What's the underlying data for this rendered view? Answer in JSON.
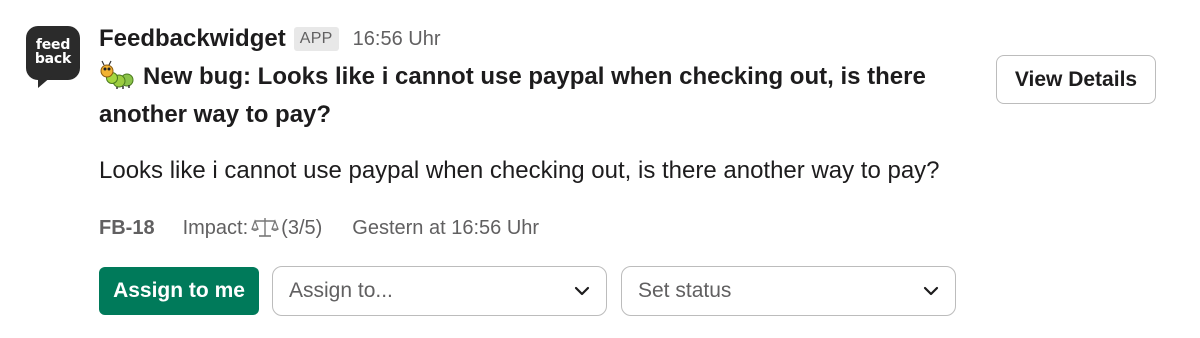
{
  "avatar": {
    "line1": "feed",
    "line2": "back",
    "color": "#2b2b2b"
  },
  "header": {
    "app_name": "Feedbackwidget",
    "badge": "APP",
    "timestamp": "16:56 Uhr"
  },
  "message": {
    "icon": "bug-icon",
    "title": "New bug: Looks like i cannot use paypal when checking out, is there another way to pay?",
    "body": "Looks like i cannot use paypal when checking out, is there another way to pay?"
  },
  "view_details_label": "View Details",
  "meta": {
    "ticket_id": "FB-18",
    "impact_label": "Impact:",
    "impact_icon": "scale-icon",
    "impact_value": "(3/5)",
    "when": "Gestern at 16:56 Uhr"
  },
  "actions": {
    "assign_me_label": "Assign to me",
    "assign_to_placeholder": "Assign to...",
    "set_status_placeholder": "Set status",
    "accent_color": "#007a5a"
  }
}
